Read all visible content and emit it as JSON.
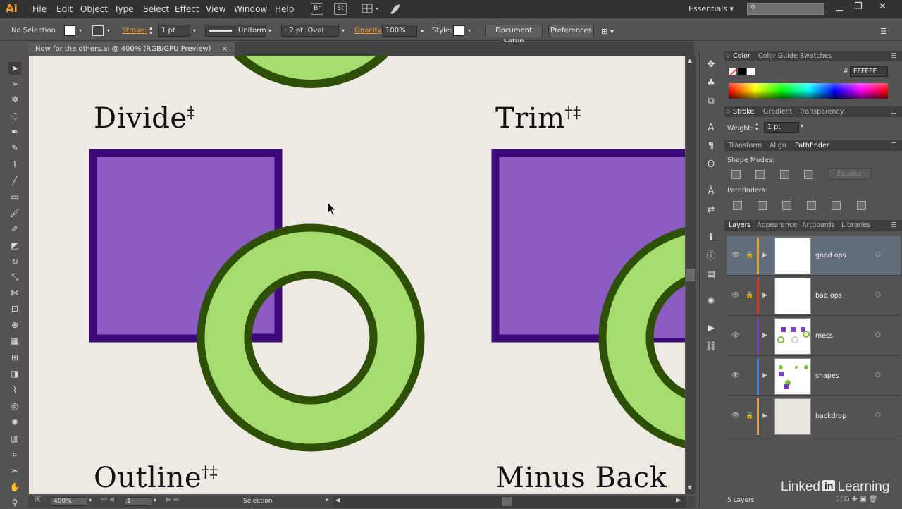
{
  "app": {
    "logo": "Ai"
  },
  "menu": [
    "File",
    "Edit",
    "Object",
    "Type",
    "Select",
    "Effect",
    "View",
    "Window",
    "Help"
  ],
  "menu_icons": [
    {
      "name": "bridge-icon",
      "label": "Br"
    },
    {
      "name": "stock-icon",
      "label": "St"
    }
  ],
  "workspace": "Essentials",
  "control_bar": {
    "selection_label": "No Selection",
    "stroke_label": "Stroke:",
    "stroke_weight": "1 pt",
    "stroke_profile": "Uniform",
    "brush": "2 pt. Oval",
    "opacity_label": "Opacity:",
    "opacity_value": "100%",
    "style_label": "Style:",
    "document_setup": "Document Setup",
    "preferences": "Preferences"
  },
  "document": {
    "tab_title": "Now for the others.ai @ 400% (RGB/GPU Preview)",
    "close_glyph": "×"
  },
  "artboard_labels": {
    "divide": "Divide",
    "divide_mark": "‡",
    "trim": "Trim",
    "trim_mark": "†‡",
    "outline": "Outline",
    "outline_mark": "†‡",
    "minus_back": "Minus Back"
  },
  "colors": {
    "canvas_bg": "#eeeae3",
    "square_fill": "#8d5cc2",
    "square_stroke": "#3a0a7a",
    "ring_fill": "#a5dc6e",
    "ring_stroke": "#2d5006",
    "accent_orange": "#f59b2f"
  },
  "status_bar": {
    "zoom": "400%",
    "artboard_number": "1",
    "tool_name": "Selection"
  },
  "color_panel": {
    "tabs": [
      "Color",
      "Color Guide",
      "Swatches"
    ],
    "hex_value": "FFFFFF"
  },
  "stroke_panel": {
    "tabs": [
      "Stroke",
      "Gradient",
      "Transparency"
    ],
    "weight_label": "Weight:",
    "weight_value": "1 pt"
  },
  "pathfinder_panel": {
    "tabs": [
      "Transform",
      "Align",
      "Pathfinder"
    ],
    "shape_modes_label": "Shape Modes:",
    "pathfinders_label": "Pathfinders:",
    "expand_label": "Expand"
  },
  "layers_panel": {
    "tabs": [
      "Layers",
      "Appearance",
      "Artboards",
      "Libraries"
    ],
    "layers": [
      {
        "name": "good ops",
        "color": "#f2a11f",
        "locked": true,
        "selected": true
      },
      {
        "name": "bad ops",
        "color": "#e8352b",
        "locked": true,
        "selected": false
      },
      {
        "name": "mess",
        "color": "#7b3fc8",
        "locked": false,
        "selected": false
      },
      {
        "name": "shapes",
        "color": "#3f7fe0",
        "locked": false,
        "selected": false
      },
      {
        "name": "backdrop",
        "color": "#e89c52",
        "locked": true,
        "selected": false
      }
    ],
    "count_label": "5 Layers"
  },
  "watermark": {
    "pre": "Linked",
    "in": "in",
    "post": "Learning"
  }
}
